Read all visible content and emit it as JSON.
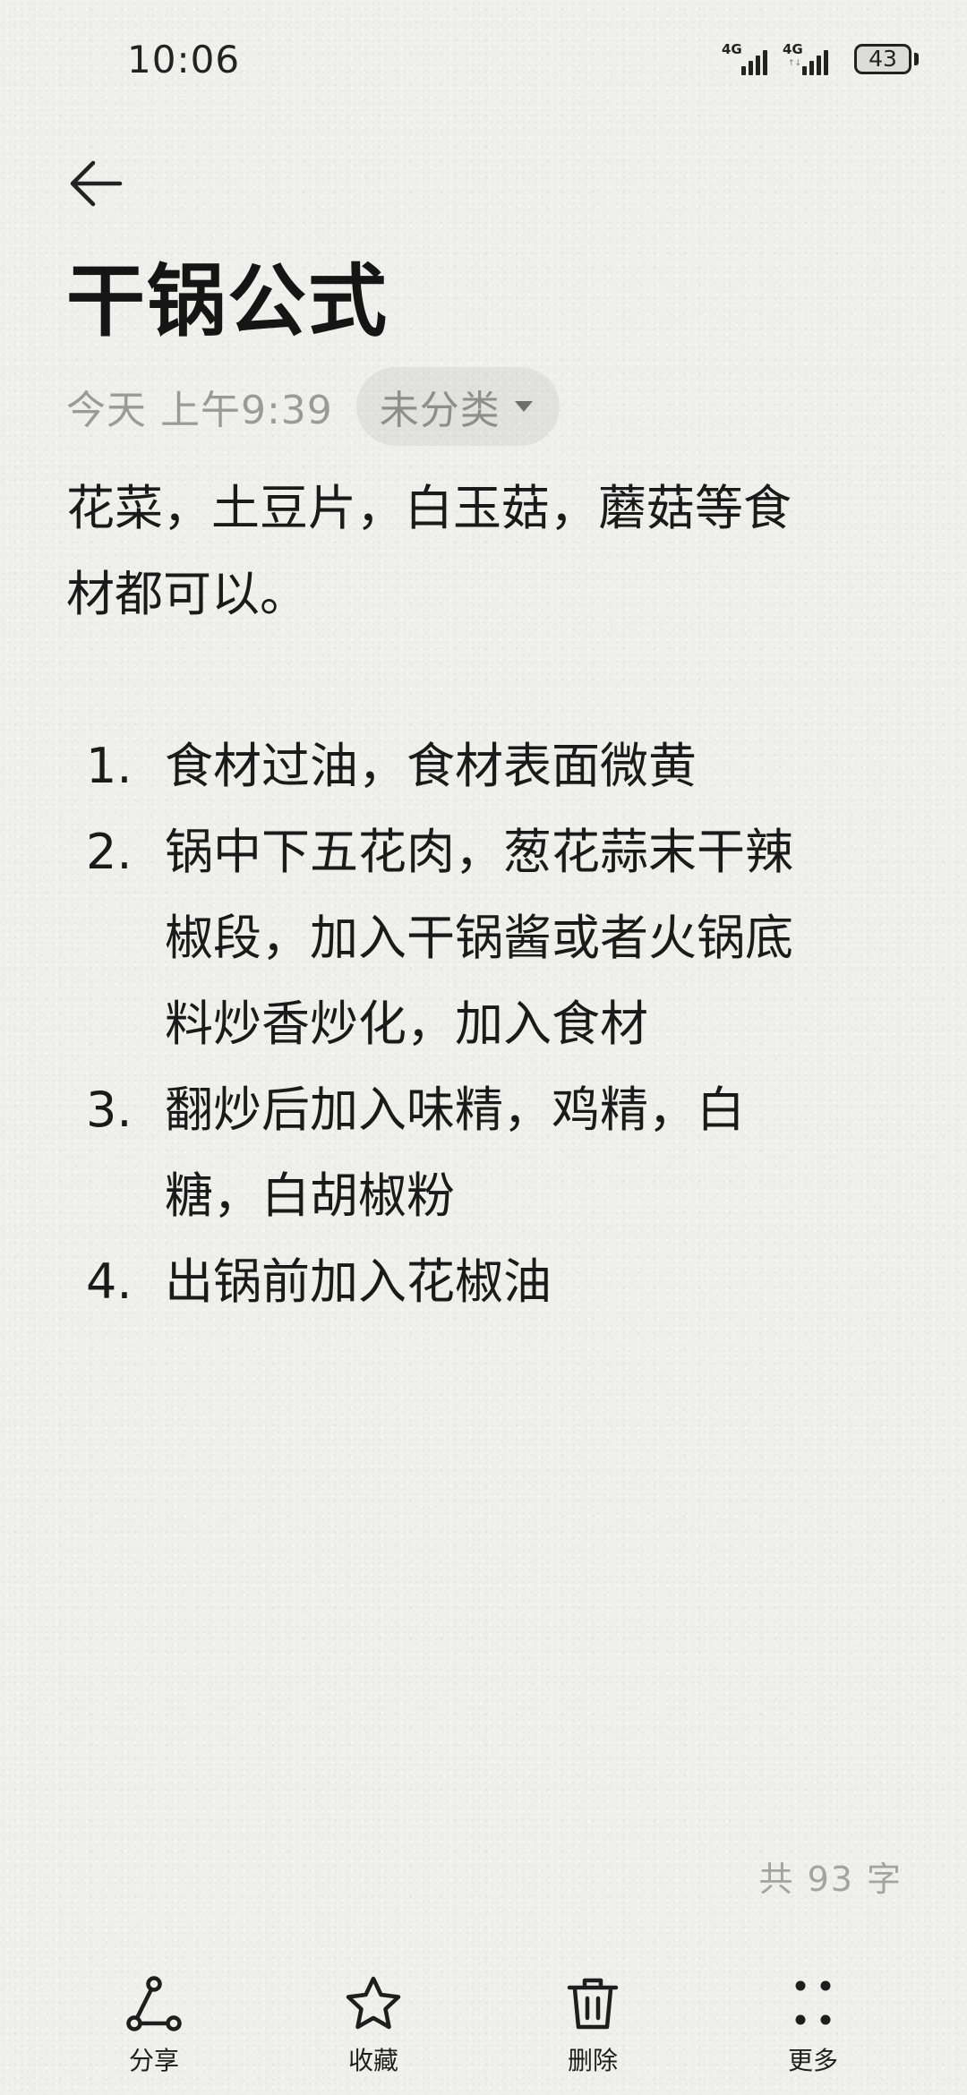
{
  "status_bar": {
    "time": "10:06",
    "network_1": "4G",
    "network_2": "4G",
    "battery_level": "43"
  },
  "header": {
    "back_icon": "arrow-left-icon"
  },
  "note": {
    "title": "干锅公式",
    "date": "今天 上午9:39",
    "category": "未分类",
    "intro_lines": [
      "花菜，土豆片，白玉菇，蘑菇等食",
      "材都可以。"
    ],
    "steps": [
      {
        "num": "1.",
        "lines": [
          "食材过油，食材表面微黄"
        ]
      },
      {
        "num": "2.",
        "lines": [
          "锅中下五花肉，葱花蒜末干辣",
          "椒段，加入干锅酱或者火锅底",
          "料炒香炒化，加入食材"
        ]
      },
      {
        "num": "3.",
        "lines": [
          "翻炒后加入味精，鸡精，白",
          "糖，白胡椒粉"
        ]
      },
      {
        "num": "4.",
        "lines": [
          "出锅前加入花椒油"
        ]
      }
    ],
    "word_count": "共 93 字"
  },
  "toolbar": {
    "share_label": "分享",
    "favorite_label": "收藏",
    "delete_label": "删除",
    "more_label": "更多",
    "icons": [
      "share-icon",
      "star-icon",
      "trash-icon",
      "more-dots-icon"
    ]
  }
}
